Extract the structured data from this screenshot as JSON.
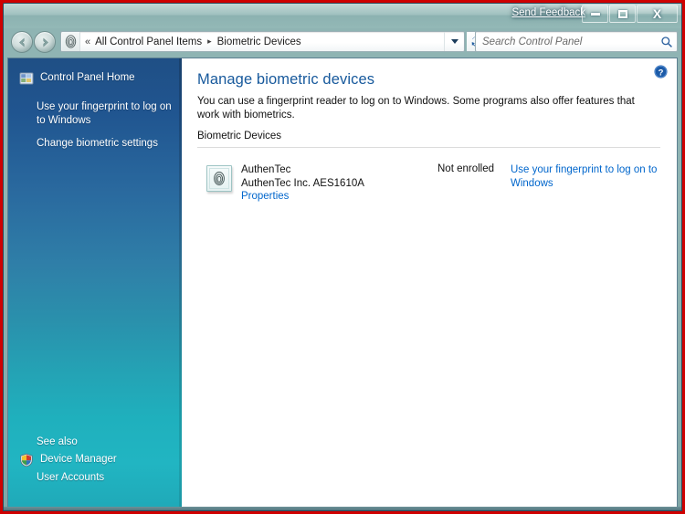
{
  "window": {
    "feedback_link": "Send Feedback",
    "buttons": {
      "minimize": "Minimize",
      "maximize": "Maximize",
      "close": "Close",
      "close_glyph": "X"
    }
  },
  "navbar": {
    "back_tooltip": "Back",
    "forward_tooltip": "Forward",
    "recent_tooltip": "Recent pages",
    "address_icon": "fingerprint-icon",
    "breadcrumb_overflow": "«",
    "breadcrumbs": [
      {
        "label": "All Control Panel Items"
      },
      {
        "label": "Biometric Devices"
      }
    ],
    "breadcrumb_separator": "▸",
    "refresh_tooltip": "Refresh",
    "search": {
      "placeholder": "Search Control Panel",
      "value": ""
    }
  },
  "sidebar": {
    "home": {
      "label": "Control Panel Home",
      "icon": "control-panel-icon"
    },
    "tasks": [
      {
        "label": "Use your fingerprint to log on to Windows"
      },
      {
        "label": "Change biometric settings"
      }
    ],
    "see_also": {
      "title": "See also",
      "items": [
        {
          "label": "Device Manager",
          "icon": "shield-icon"
        },
        {
          "label": "User Accounts",
          "icon": "none"
        }
      ]
    }
  },
  "content": {
    "help_tooltip": "Help",
    "title": "Manage biometric devices",
    "description": "You can use a fingerprint reader to log on to Windows. Some programs also offer features that work with biometrics.",
    "section_label": "Biometric Devices",
    "devices": [
      {
        "icon": "fingerprint-reader-icon",
        "name": "AuthenTec",
        "model": "AuthenTec Inc. AES1610A",
        "properties_link": "Properties",
        "status": "Not enrolled",
        "action_link": "Use your fingerprint to log on to Windows"
      }
    ]
  },
  "colors": {
    "accent_link": "#0066cc",
    "title_blue": "#17599c",
    "sidebar_top": "#1f4f85",
    "sidebar_bottom": "#1fa9b8",
    "annotation_border": "#cf0000"
  }
}
